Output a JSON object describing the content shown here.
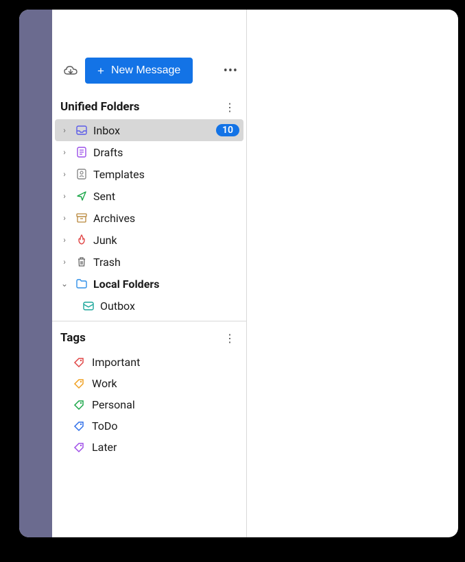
{
  "toolbar": {
    "new_message_label": "New Message"
  },
  "folders": {
    "section_title": "Unified Folders",
    "items": [
      {
        "label": "Inbox",
        "badge": "10",
        "selected": true
      },
      {
        "label": "Drafts"
      },
      {
        "label": "Templates"
      },
      {
        "label": "Sent"
      },
      {
        "label": "Archives"
      },
      {
        "label": "Junk"
      },
      {
        "label": "Trash"
      },
      {
        "label": "Local Folders",
        "bold": true,
        "expanded": true
      },
      {
        "label": "Outbox",
        "child": true
      }
    ]
  },
  "tags": {
    "section_title": "Tags",
    "items": [
      {
        "label": "Important",
        "color": "#e04545"
      },
      {
        "label": "Work",
        "color": "#f0a020"
      },
      {
        "label": "Personal",
        "color": "#1aa648"
      },
      {
        "label": "ToDo",
        "color": "#2f6fe8"
      },
      {
        "label": "Later",
        "color": "#9f4ee8"
      }
    ]
  }
}
